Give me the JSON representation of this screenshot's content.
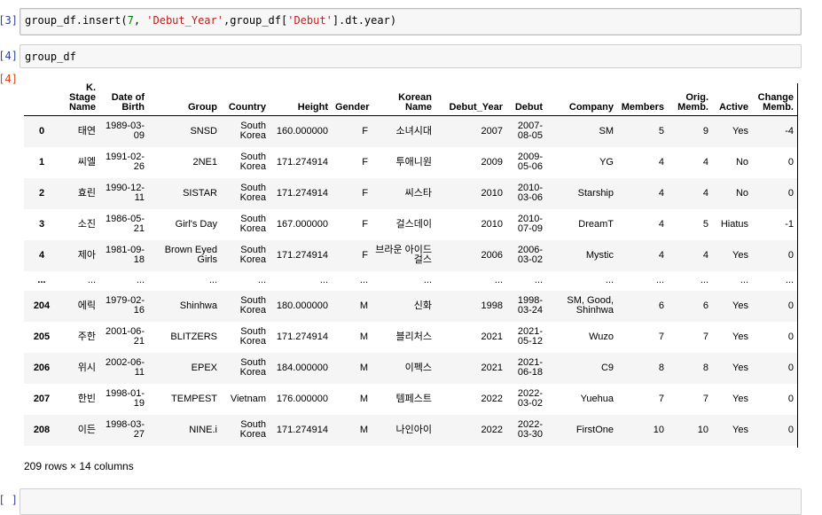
{
  "cells": {
    "c1_prompt": "[3]:",
    "c1_code": {
      "a": "group_df.insert(",
      "num": "7",
      "b": ", ",
      "str1": "'Debut_Year'",
      "c": ",group_df[",
      "str2": "'Debut'",
      "d": "].dt.year)"
    },
    "c2_prompt": "[4]:",
    "c2_code": "group_df",
    "out_prompt": "[4]:",
    "next_prompt": "[ ]:"
  },
  "table": {
    "columns": [
      "",
      "K. Stage Name",
      "Date of Birth",
      "Group",
      "Country",
      "Height",
      "Gender",
      "Korean Name",
      "Debut_Year",
      "Debut",
      "Company",
      "Members",
      "Orig. Memb.",
      "Active",
      "Change Memb."
    ],
    "rows": [
      [
        "0",
        "태연",
        "1989-03-09",
        "SNSD",
        "South Korea",
        "160.000000",
        "F",
        "소녀시대",
        "2007",
        "2007-08-05",
        "SM",
        "5",
        "9",
        "Yes",
        "-4"
      ],
      [
        "1",
        "씨엘",
        "1991-02-26",
        "2NE1",
        "South Korea",
        "171.274914",
        "F",
        "투애니원",
        "2009",
        "2009-05-06",
        "YG",
        "4",
        "4",
        "No",
        "0"
      ],
      [
        "2",
        "효린",
        "1990-12-11",
        "SISTAR",
        "South Korea",
        "171.274914",
        "F",
        "씨스타",
        "2010",
        "2010-03-06",
        "Starship",
        "4",
        "4",
        "No",
        "0"
      ],
      [
        "3",
        "소진",
        "1986-05-21",
        "Girl's Day",
        "South Korea",
        "167.000000",
        "F",
        "걸스데이",
        "2010",
        "2010-07-09",
        "DreamT",
        "4",
        "5",
        "Hiatus",
        "-1"
      ],
      [
        "4",
        "제아",
        "1981-09-18",
        "Brown Eyed Girls",
        "South Korea",
        "171.274914",
        "F",
        "브라운 아이드 걸스",
        "2006",
        "2006-03-02",
        "Mystic",
        "4",
        "4",
        "Yes",
        "0"
      ],
      [
        "...",
        "...",
        "...",
        "...",
        "...",
        "...",
        "...",
        "...",
        "...",
        "...",
        "...",
        "...",
        "...",
        "...",
        "..."
      ],
      [
        "204",
        "에릭",
        "1979-02-16",
        "Shinhwa",
        "South Korea",
        "180.000000",
        "M",
        "신화",
        "1998",
        "1998-03-24",
        "SM, Good, Shinhwa",
        "6",
        "6",
        "Yes",
        "0"
      ],
      [
        "205",
        "주한",
        "2001-06-21",
        "BLITZERS",
        "South Korea",
        "171.274914",
        "M",
        "블리처스",
        "2021",
        "2021-05-12",
        "Wuzo",
        "7",
        "7",
        "Yes",
        "0"
      ],
      [
        "206",
        "위시",
        "2002-06-11",
        "EPEX",
        "South Korea",
        "184.000000",
        "M",
        "이펙스",
        "2021",
        "2021-06-18",
        "C9",
        "8",
        "8",
        "Yes",
        "0"
      ],
      [
        "207",
        "한빈",
        "1998-01-19",
        "TEMPEST",
        "Vietnam",
        "176.000000",
        "M",
        "템페스트",
        "2022",
        "2022-03-02",
        "Yuehua",
        "7",
        "7",
        "Yes",
        "0"
      ],
      [
        "208",
        "이든",
        "1998-03-27",
        "NINE.i",
        "South Korea",
        "171.274914",
        "M",
        "나인아이",
        "2022",
        "2022-03-30",
        "FirstOne",
        "10",
        "10",
        "Yes",
        "0"
      ]
    ],
    "shape": "209 rows × 14 columns"
  },
  "colors": {
    "input_prompt": "#303f9f",
    "output_prompt": "#d84315",
    "string": "#ba2121",
    "number": "#008000",
    "row_stripe": "#f5f5f5"
  }
}
